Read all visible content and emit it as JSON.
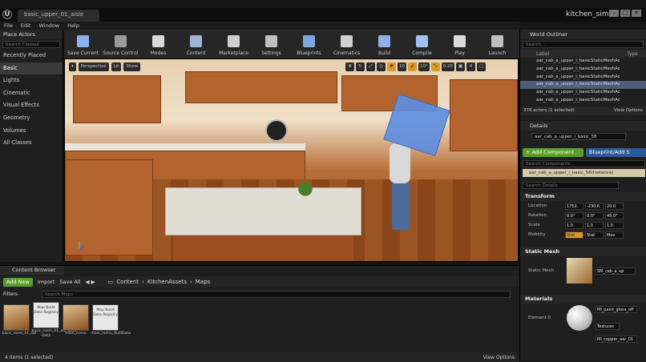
{
  "titlebar": {
    "logo": "U",
    "tab": "basic_upper_01_aisle",
    "project": "kitchen_sim",
    "buttons": [
      "–",
      "□",
      "✕"
    ]
  },
  "menu": [
    "File",
    "Edit",
    "Window",
    "Help"
  ],
  "place_actors": {
    "title": "Place Actors",
    "search_placeholder": "Search Classes",
    "categories": [
      "Recently Placed",
      "Basic",
      "Lights",
      "Cinematic",
      "Visual Effects",
      "Geometry",
      "Volumes",
      "All Classes"
    ],
    "selected": "Basic"
  },
  "toolbar": {
    "items": [
      {
        "label": "Save Current",
        "icon": "save-icon",
        "color": "#8ab4e8"
      },
      {
        "label": "Source Control",
        "icon": "source-control-icon",
        "color": "#9a9a9a"
      },
      {
        "label": "Modes",
        "icon": "modes-icon",
        "color": "#d8d8d8"
      },
      {
        "label": "Content",
        "icon": "content-icon",
        "color": "#9fb6d8"
      },
      {
        "label": "Marketplace",
        "icon": "marketplace-icon",
        "color": "#cfcfcf"
      },
      {
        "label": "Settings",
        "icon": "settings-icon",
        "color": "#bfbfbf"
      },
      {
        "label": "Blueprints",
        "icon": "blueprints-icon",
        "color": "#7fa6e0"
      },
      {
        "label": "Cinematics",
        "icon": "cinematics-icon",
        "color": "#cfcfcf"
      },
      {
        "label": "Build",
        "icon": "build-icon",
        "color": "#8fb0e8"
      },
      {
        "label": "Compile",
        "icon": "compile-icon",
        "color": "#9fc0f0"
      },
      {
        "label": "Play",
        "icon": "play-icon",
        "color": "#dcdcdc"
      },
      {
        "label": "Launch",
        "icon": "launch-icon",
        "color": "#bfbfbf"
      }
    ]
  },
  "viewport": {
    "perspective": "Perspective",
    "lit": "Lit",
    "show": "Show",
    "snap_values": [
      "10",
      "10°",
      "0.25",
      "4"
    ]
  },
  "outliner": {
    "title": "World Outliner",
    "search_placeholder": "Search...",
    "col_label": "Label",
    "col_type": "Type",
    "rows": [
      "aar_cab_a_upper_l_basicStaticMeshAc",
      "aar_cab_a_upper_l_basicStaticMeshAc",
      "aar_cab_a_upper_l_basicStaticMeshAc",
      "aar_cab_a_upper_l_basicStaticMeshAc",
      "aar_cab_a_upper_l_basicStaticMeshAc",
      "aar_cab_a_upper_l_basicStaticMeshAc"
    ],
    "selected_index": 3,
    "footer": "378 actors (1 selected)",
    "view_options": "View Options"
  },
  "details": {
    "title": "Details",
    "object_name": "aar_cab_a_upper_l_basic_56",
    "add_component": "+ Add Component",
    "blueprint": "Blueprint/Add S",
    "search_components": "Search Components",
    "instance": "aar_cab_a_upper_l_basic_56(Instance)",
    "search_details": "Search Details",
    "transform": "Transform",
    "location_label": "Location",
    "location": [
      "1752.",
      "-230.6",
      "20.0"
    ],
    "rotation_label": "Rotation",
    "rotation": [
      "0.0°",
      "0.0°",
      "45.0°"
    ],
    "scale_label": "Scale",
    "scale": [
      "1.0",
      "1.0",
      "1.0"
    ],
    "mobility_label": "Mobility",
    "mobility": [
      "Stat",
      "Stat",
      "Mov"
    ],
    "static_mesh_section": "Static Mesh",
    "static_mesh_label": "Static Mesh",
    "static_mesh_value": "SM_cab_a_up",
    "materials_section": "Materials",
    "element_label": "Element 0",
    "material_value": "MI_paint_gloss_off",
    "textures": "Textures",
    "material2": "MI_copper_aar_01"
  },
  "content_browser": {
    "tab": "Content Browser",
    "add_new": "Add New",
    "import": "Import",
    "save_all": "Save All",
    "breadcrumb": [
      "Content",
      "KitchenAssets",
      "Maps"
    ],
    "filters": "Filters",
    "search_placeholder": "Search Maps",
    "assets": [
      {
        "label": "basic_room_01_aar",
        "type": "map"
      },
      {
        "label": "basic_room_01_aar_Built Data",
        "type": "doc",
        "thumb": "Map Build Data Registry"
      },
      {
        "label": "main_menu",
        "type": "map"
      },
      {
        "label": "main_menu_BuiltData",
        "type": "doc",
        "thumb": "Map Build Data Registry"
      }
    ],
    "footer": "4 items (1 selected)",
    "view_options": "View Options"
  }
}
